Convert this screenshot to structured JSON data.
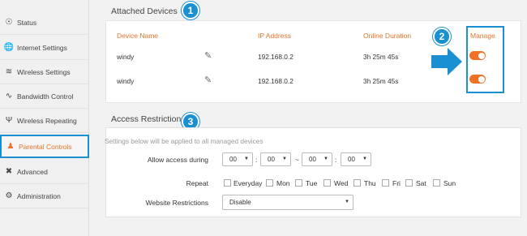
{
  "sidebar": {
    "items": [
      {
        "label": "Status",
        "icon": "globe-icon"
      },
      {
        "label": "Internet Settings",
        "icon": "globe-icon"
      },
      {
        "label": "Wireless Settings",
        "icon": "wifi-icon"
      },
      {
        "label": "Bandwidth Control",
        "icon": "bandwidth-icon"
      },
      {
        "label": "Wireless Repeating",
        "icon": "repeater-icon"
      },
      {
        "label": "Parental Controls",
        "icon": "parental-icon"
      },
      {
        "label": "Advanced",
        "icon": "tools-icon"
      },
      {
        "label": "Administration",
        "icon": "gear-icon"
      }
    ],
    "active_index": 5
  },
  "attached_devices": {
    "title": "Attached Devices",
    "badge": "1",
    "headers": {
      "device_name": "Device Name",
      "ip_address": "IP Address",
      "online_duration": "Online Duration",
      "manage": "Manage"
    },
    "rows": [
      {
        "name": "windy",
        "ip": "192.168.0.2",
        "duration": "3h 25m 45s",
        "manage_on": true
      },
      {
        "name": "windy",
        "ip": "192.168.0.2",
        "duration": "3h 25m 45s",
        "manage_on": true
      }
    ],
    "manage_badge": "2"
  },
  "access_restrictions": {
    "title": "Access Restrictions",
    "badge": "3",
    "note": "Settings below will be applied to all managed devices",
    "allow_label": "Allow access during",
    "time": {
      "start_hour": "00",
      "start_min": "00",
      "end_hour": "00",
      "end_min": "00",
      "sep": ":",
      "range": "~"
    },
    "repeat_label": "Repeat",
    "days": [
      "Everyday",
      "Mon",
      "Tue",
      "Wed",
      "Thu",
      "Fri",
      "Sat",
      "Sun"
    ],
    "website_label": "Website Restrictions",
    "website_value": "Disable"
  },
  "colors": {
    "accent": "#e8732a",
    "highlight": "#1a8fd1",
    "toggle": "#f07124"
  }
}
